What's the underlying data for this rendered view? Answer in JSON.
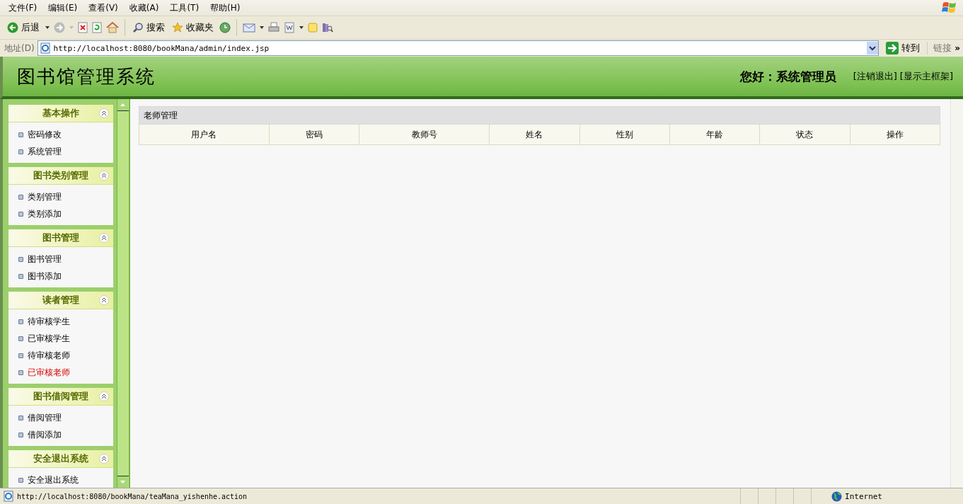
{
  "browser": {
    "menu": [
      "文件(F)",
      "编辑(E)",
      "查看(V)",
      "收藏(A)",
      "工具(T)",
      "帮助(H)"
    ],
    "toolbar": {
      "back": "后退",
      "search": "搜索",
      "favorites": "收藏夹"
    },
    "address": {
      "label": "地址(D)",
      "value": "http://localhost:8080/bookMana/admin/index.jsp",
      "go": "转到",
      "links": "链接",
      "more": "»"
    }
  },
  "header": {
    "title": "图书馆管理系统",
    "greeting": "您好：系统管理员",
    "links": [
      "[注销退出]",
      "[显示主框架]"
    ]
  },
  "sidebar": {
    "sections": [
      {
        "title": "基本操作",
        "expanded": true,
        "items": [
          {
            "label": "密码修改",
            "selected": false
          },
          {
            "label": "系统管理",
            "selected": false
          }
        ]
      },
      {
        "title": "图书类别管理",
        "expanded": true,
        "items": [
          {
            "label": "类别管理",
            "selected": false
          },
          {
            "label": "类别添加",
            "selected": false
          }
        ]
      },
      {
        "title": "图书管理",
        "expanded": true,
        "items": [
          {
            "label": "图书管理",
            "selected": false
          },
          {
            "label": "图书添加",
            "selected": false
          }
        ]
      },
      {
        "title": "读者管理",
        "expanded": true,
        "items": [
          {
            "label": "待审核学生",
            "selected": false
          },
          {
            "label": "已审核学生",
            "selected": false
          },
          {
            "label": "待审核老师",
            "selected": false
          },
          {
            "label": "已审核老师",
            "selected": true
          }
        ]
      },
      {
        "title": "图书借阅管理",
        "expanded": true,
        "items": [
          {
            "label": "借阅管理",
            "selected": false
          },
          {
            "label": "借阅添加",
            "selected": false
          }
        ]
      },
      {
        "title": "安全退出系统",
        "expanded": true,
        "items": [
          {
            "label": "安全退出系统",
            "selected": false
          }
        ]
      }
    ]
  },
  "panel": {
    "title": "老师管理",
    "columns": [
      "用户名",
      "密码",
      "教师号",
      "姓名",
      "性别",
      "年龄",
      "状态",
      "操作"
    ]
  },
  "status_bar": {
    "url": "http://localhost:8080/bookMana/teaMana_yishenhe.action",
    "zone": "Internet"
  }
}
